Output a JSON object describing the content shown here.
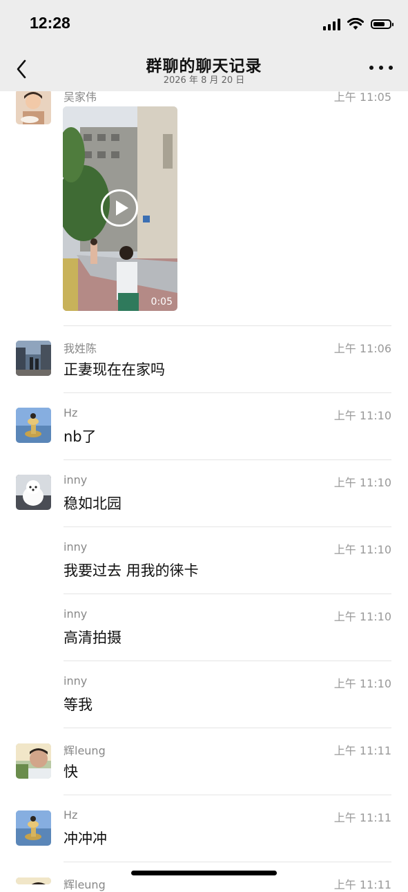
{
  "status_bar": {
    "time": "12:28"
  },
  "nav": {
    "title": "群聊的聊天记录",
    "date": "2026 年 8 月 20 日"
  },
  "video": {
    "duration": "0:05"
  },
  "messages": [
    {
      "sender": "吴家伟",
      "time": "上午 11:05",
      "text": ""
    },
    {
      "sender": "我姓陈",
      "time": "上午 11:06",
      "text": "正妻现在在家吗"
    },
    {
      "sender": "Hz",
      "time": "上午 11:10",
      "text": "nb了"
    },
    {
      "sender": "inny",
      "time": "上午 11:10",
      "text": "稳如北园"
    },
    {
      "sender": "inny",
      "time": "上午 11:10",
      "text": "我要过去 用我的徕卡"
    },
    {
      "sender": "inny",
      "time": "上午 11:10",
      "text": "高清拍摄"
    },
    {
      "sender": "inny",
      "time": "上午 11:10",
      "text": "等我"
    },
    {
      "sender": "辉leung",
      "time": "上午 11:11",
      "text": "快"
    },
    {
      "sender": "Hz",
      "time": "上午 11:11",
      "text": "冲冲冲"
    },
    {
      "sender": "辉leung",
      "time": "上午 11:11",
      "text": ""
    }
  ]
}
